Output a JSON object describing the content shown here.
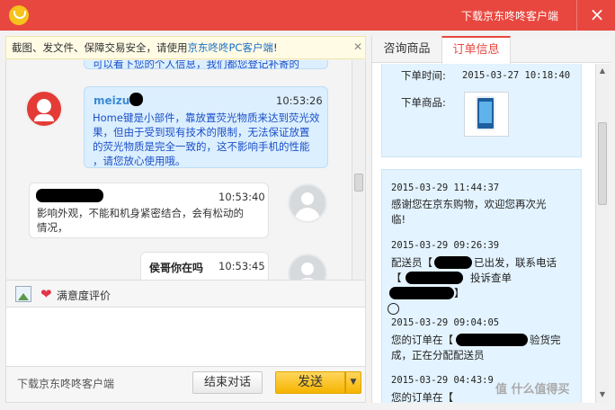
{
  "titlebar": {
    "download_link": "下载京东咚咚客户端",
    "close_icon": "×"
  },
  "notice": {
    "text_prefix": "截图、发文件、保障交易安全，请使用",
    "link_text": "京东咚咚PC客户端",
    "text_suffix": "!",
    "close_icon": "✕"
  },
  "chat": {
    "partial_top": "可以看下您的个人信息，我们都您登记补寄的",
    "messages": [
      {
        "sender": "meizu",
        "time": "10:53:26",
        "lines": [
          "Home键是小部件，靠放置荧光物质来达到荧光效",
          "果，但由于受到现有技术的限制，无法保证放置",
          "的荧光物质是完全一致的，这不影响手机的性能",
          "，请您放心使用哦。"
        ]
      },
      {
        "sender": "",
        "time": "10:53:40",
        "lines": [
          "影响外观，不能和机身紧密结合，会有松动的",
          "情况，"
        ]
      },
      {
        "sender": "侯哥你在吗",
        "time": "10:53:45",
        "lines": []
      }
    ]
  },
  "toolbar": {
    "rating_label": "满意度评价",
    "heart_icon": "❤"
  },
  "bottombar": {
    "download_label": "下载京东咚咚客户端",
    "end_label": "结束对话",
    "send_label": "发送",
    "send_drop_icon": "▼"
  },
  "tabs": {
    "consult": "咨询商品",
    "order": "订单信息"
  },
  "order": {
    "order_time_label": "下单时间:",
    "order_time_value": "2015-03-27 10:18:40",
    "order_goods_label": "下单商品:",
    "tracking": [
      {
        "time": "2015-03-29 11:44:37",
        "lines": [
          "感谢您在京东购物，欢迎您再次光",
          "临!"
        ]
      },
      {
        "time": "2015-03-29 09:26:39",
        "lines": [
          "配送员【",
          "已出发，联系电话",
          "【",
          "投诉查单",
          "】"
        ]
      },
      {
        "time": "2015-03-29 09:04:05",
        "lines": [
          "您的订单在【",
          "验货完",
          "成，正在分配配送员"
        ]
      },
      {
        "time": "2015-03-29 04:43:9",
        "lines": [
          "您的订单在【"
        ]
      }
    ]
  },
  "watermark": "值 什么值得买"
}
